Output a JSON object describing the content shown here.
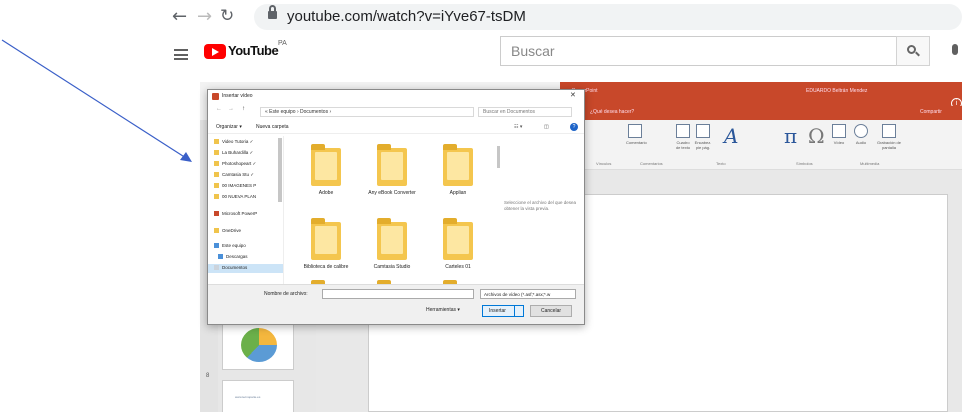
{
  "browser": {
    "url": "youtube.com/watch?v=iYve67-tsDM"
  },
  "youtube": {
    "logo_text": "YouTube",
    "region": "PA",
    "search_placeholder": "Buscar"
  },
  "powerpoint": {
    "title": "PowerPoint",
    "user": "EDUARDO Beltrán Mendez",
    "tell_me": "¿Qué desea hacer?",
    "tabs": [
      "ientos"
    ],
    "share": "Compartir",
    "ribbon_items": [
      "Comentario",
      "Cuadro de texto",
      "Encabez. pie pág.",
      "WordArt",
      "Ecuación",
      "Símbolo",
      "Vídeo",
      "Audio",
      "Grabación de pantalla"
    ],
    "ribbon_groups": [
      "Vínculos",
      "Comentarios",
      "Texto",
      "Símbolos",
      "Multimedia"
    ],
    "slide2_text": "www.tecnoparte.es"
  },
  "dialog": {
    "title": "Insertar vídeo",
    "breadcrumb": "« Este equipo › Documentos ›",
    "search_placeholder": "Buscar en Documentos",
    "organize": "Organizar ▾",
    "new_folder": "Nueva carpeta",
    "nav_items": [
      "Video Tutoria  ✓",
      "La Buhardilla ✓",
      "Photoshopeart ✓",
      "Camtasia Stu ✓",
      "00 IMAGENES P",
      "00 NUEVA PLAN",
      "Microsoft PowerP",
      "OneDrive",
      "Este equipo",
      "Descargas",
      "Documentos"
    ],
    "files": [
      "Adobe",
      "Any eBook Converter",
      "Applian",
      "Biblioteca de calibre",
      "Camtasia Studio",
      "Carteles 01"
    ],
    "preview_text": "Seleccione el archivo del que desea obtener la vista previa.",
    "filename_label": "Nombre de archivo:",
    "filter": "Archivos de vídeo (*.asf;*.asx;*.w",
    "tools": "Herramientas ▾",
    "insert": "Insertar",
    "cancel": "Cancelar"
  },
  "colors": {
    "ppt_accent": "#c8482a",
    "youtube_red": "#ff0000",
    "arrow": "#3a5fc8"
  }
}
